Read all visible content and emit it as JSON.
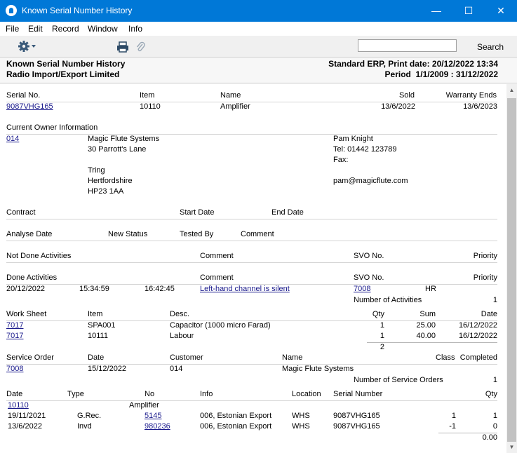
{
  "window": {
    "title": "Known Serial Number History"
  },
  "menu": {
    "file": "File",
    "edit": "Edit",
    "record": "Record",
    "window": "Window",
    "info": "Info"
  },
  "toolbar": {
    "search_value": "",
    "search_label": "Search"
  },
  "header": {
    "report_title": "Known Serial Number History",
    "company": "Radio Import/Export Limited",
    "print_info": "Standard ERP, Print date: 20/12/2022 13:34",
    "period": "Period  1/1/2009 : 31/12/2022"
  },
  "serial": {
    "headers": {
      "serial_no": "Serial No.",
      "item": "Item",
      "name": "Name",
      "sold": "Sold",
      "warranty": "Warranty Ends"
    },
    "values": {
      "serial_no": "9087VHG165",
      "item": "10110",
      "name": "Amplifier",
      "sold": "13/6/2022",
      "warranty": "13/6/2023"
    }
  },
  "owner": {
    "heading": "Current Owner Information",
    "code": "014",
    "name": "Magic Flute Systems",
    "address1": "30 Parrott's Lane",
    "address2": "Tring",
    "address3": "Hertfordshire",
    "address4": "HP23 1AA",
    "contact": "Pam Knight",
    "tel": "Tel: 01442 123789",
    "fax": "Fax:",
    "email": "pam@magicflute.com"
  },
  "contract": {
    "contract": "Contract",
    "start": "Start Date",
    "end": "End Date"
  },
  "analyse": {
    "date": "Analyse Date",
    "status": "New Status",
    "tested": "Tested By",
    "comment": "Comment"
  },
  "not_done": {
    "label": "Not Done Activities",
    "comment": "Comment",
    "svo": "SVO No.",
    "priority": "Priority"
  },
  "done": {
    "label": "Done Activities",
    "comment": "Comment",
    "svo": "SVO No.",
    "priority": "Priority",
    "row": {
      "date": "20/12/2022",
      "start": "15:34:59",
      "end": "16:42:45",
      "comment": "Left-hand channel is silent",
      "svo": "7008",
      "priority": "HR"
    },
    "count_label": "Number of Activities",
    "count": "1"
  },
  "worksheet": {
    "headers": {
      "ws": "Work Sheet",
      "item": "Item",
      "desc": "Desc.",
      "qty": "Qty",
      "sum": "Sum",
      "date": "Date"
    },
    "rows": [
      {
        "ws": "7017",
        "item": "SPA001",
        "desc": "Capacitor (1000 micro Farad)",
        "qty": "1",
        "sum": "25.00",
        "date": "16/12/2022"
      },
      {
        "ws": "7017",
        "item": "10111",
        "desc": "Labour",
        "qty": "1",
        "sum": "40.00",
        "date": "16/12/2022"
      }
    ],
    "total_qty": "2"
  },
  "service_order": {
    "headers": {
      "so": "Service Order",
      "date": "Date",
      "customer": "Customer",
      "name": "Name",
      "class": "Class",
      "completed": "Completed"
    },
    "row": {
      "so": "7008",
      "date": "15/12/2022",
      "customer": "014",
      "name": "Magic Flute Systems"
    },
    "count_label": "Number of Service Orders",
    "count": "1"
  },
  "transactions": {
    "headers": {
      "date": "Date",
      "type": "Type",
      "no": "No",
      "info": "Info",
      "location": "Location",
      "serial": "Serial Number",
      "qty": "Qty"
    },
    "item_code": "10110",
    "item_name": "Amplifier",
    "rows": [
      {
        "date": "19/11/2021",
        "type": "G.Rec.",
        "no": "5145",
        "info": "006, Estonian Export",
        "location": "WHS",
        "serial": "9087VHG165",
        "qty1": "1",
        "qty2": "1"
      },
      {
        "date": "13/6/2022",
        "type": "Invd",
        "no": "980236",
        "info": "006, Estonian Export",
        "location": "WHS",
        "serial": "9087VHG165",
        "qty1": "-1",
        "qty2": "0"
      }
    ],
    "total": "0.00"
  }
}
